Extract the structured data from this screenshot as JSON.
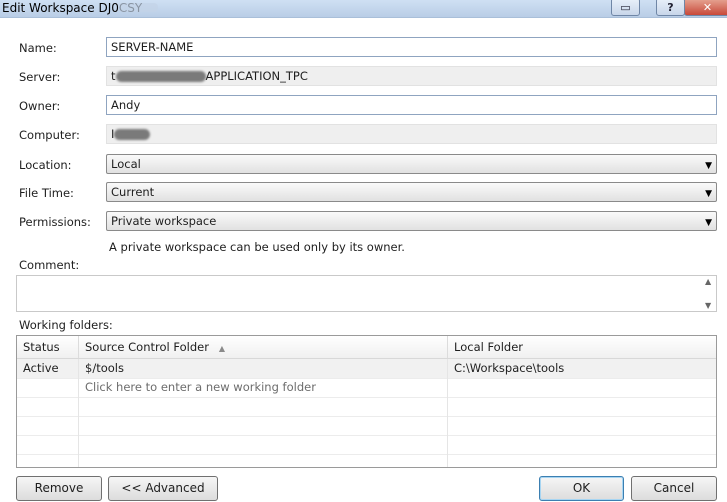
{
  "window": {
    "title": "Edit Workspace DJ0CSY",
    "help_label": "?",
    "close_label": "✕",
    "restore_label": "▭"
  },
  "form": {
    "name_label": "Name:",
    "name_value": "SERVER-NAME",
    "server_label": "Server:",
    "server_prefix": "t",
    "server_value": "APPLICATION_TPC",
    "owner_label": "Owner:",
    "owner_value": "Andy",
    "computer_label": "Computer:",
    "computer_prefix": "I",
    "location_label": "Location:",
    "location_value": "Local",
    "filetime_label": "File Time:",
    "filetime_value": "Current",
    "permissions_label": "Permissions:",
    "permissions_value": "Private workspace",
    "permissions_hint": "A private workspace can be used only by its owner.",
    "comment_label": "Comment:",
    "comment_value": ""
  },
  "working_folders": {
    "label": "Working folders:",
    "columns": [
      "Status",
      "Source Control Folder",
      "Local Folder"
    ],
    "sorted_column": "Source Control Folder",
    "rows": [
      {
        "status": "Active",
        "source": "$/tools",
        "local": "C:\\Workspace\\tools"
      }
    ],
    "new_row_placeholder": "Click here to enter a new working folder"
  },
  "buttons": {
    "remove": "Remove",
    "advanced": "<< Advanced",
    "ok": "OK",
    "cancel": "Cancel"
  }
}
